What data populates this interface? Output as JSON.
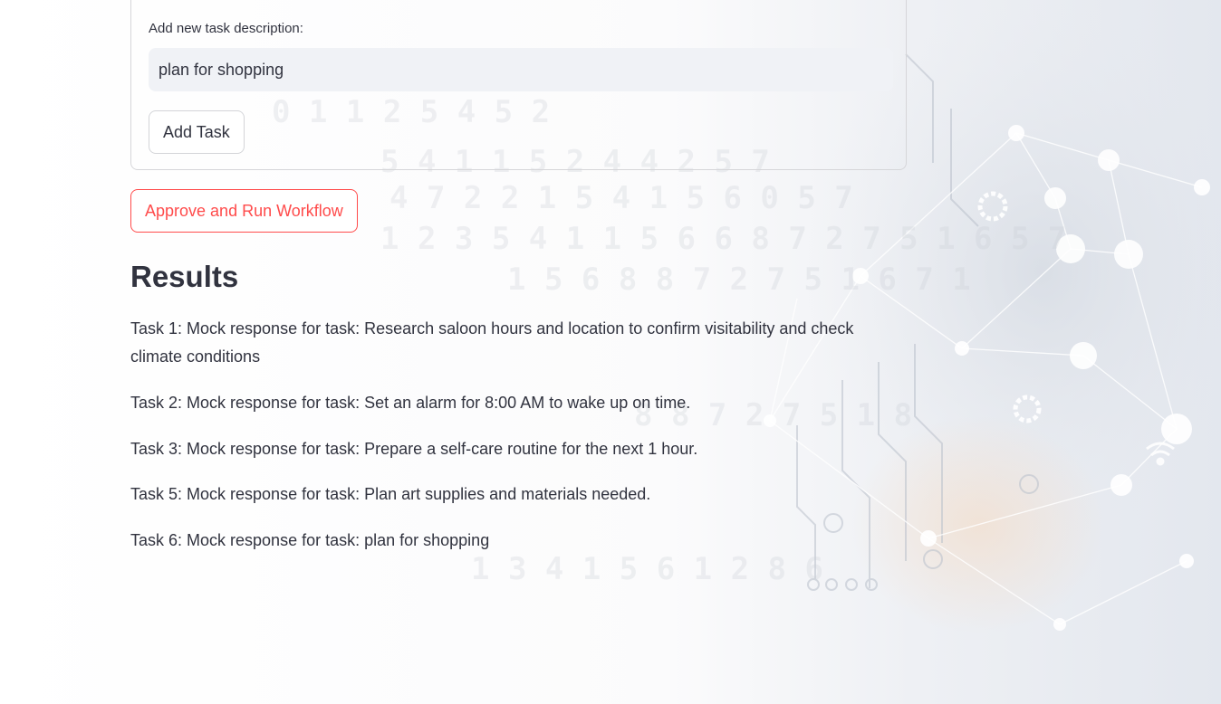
{
  "form": {
    "task_label": "Add new task description:",
    "task_value": "plan for shopping",
    "add_button_label": "Add Task"
  },
  "workflow": {
    "run_button_label": "Approve and Run Workflow"
  },
  "results": {
    "title": "Results",
    "lines": [
      "Task 1: Mock response for task: Research saloon hours and location to confirm visitability and check climate conditions",
      "Task 2: Mock response for task: Set an alarm for 8:00 AM to wake up on time.",
      "Task 3: Mock response for task: Prepare a self-care routine for the next 1 hour.",
      "Task 5: Mock response for task: Plan art supplies and materials needed.",
      "Task 6: Mock response for task: plan for shopping"
    ]
  },
  "colors": {
    "accent": "#ff4b4b",
    "text": "#31333f",
    "input_bg": "#f0f2f6"
  }
}
